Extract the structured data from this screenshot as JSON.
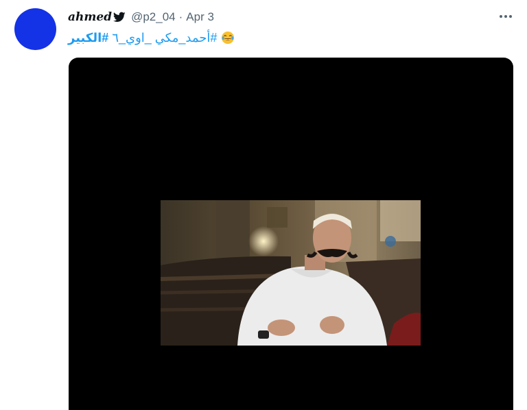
{
  "tweet": {
    "author_name": "ahmed",
    "handle": "@p2_04",
    "separator": "·",
    "date": "Apr 3",
    "text": {
      "hashtag_1": "#أحمد_مكي _اوي_٦",
      "hashtag_2": "#الكبير",
      "emoji": "tears-of-joy-emoji"
    }
  },
  "colors": {
    "avatar": "#1432e6",
    "link": "#1d9bf0",
    "secondary_text": "#536471",
    "media_background": "#000000"
  },
  "icons": {
    "verified_badge": "twitter-bird-icon",
    "more": "more-options-icon"
  }
}
